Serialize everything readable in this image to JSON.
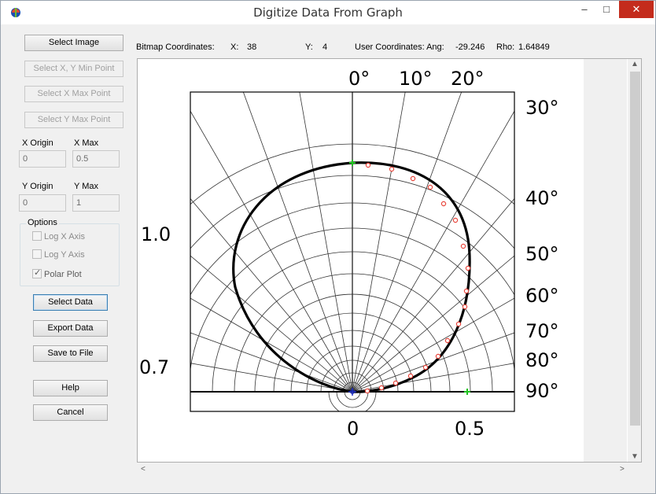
{
  "window": {
    "title": "Digitize Data From Graph",
    "minimize": "–",
    "maximize": "□",
    "close": "✕"
  },
  "buttons": {
    "select_image": "Select Image",
    "select_min": "Select X, Y Min Point",
    "select_xmax": "Select X Max Point",
    "select_ymax": "Select Y Max Point",
    "select_data": "Select Data",
    "export_data": "Export Data",
    "save_file": "Save to File",
    "help": "Help",
    "cancel": "Cancel"
  },
  "fields": {
    "x_origin_label": "X Origin",
    "x_origin_value": "0",
    "x_max_label": "X Max",
    "x_max_value": "0.5",
    "y_origin_label": "Y Origin",
    "y_origin_value": "0",
    "y_max_label": "Y Max",
    "y_max_value": "1"
  },
  "options": {
    "legend": "Options",
    "log_x": "Log X Axis",
    "log_y": "Log Y Axis",
    "polar": "Polar Plot",
    "log_x_checked": false,
    "log_y_checked": false,
    "polar_checked": true
  },
  "coords": {
    "bitmap_label": "Bitmap Coordinates:",
    "x_label": "X:",
    "x_value": "38",
    "y_label": "Y:",
    "y_value": "4",
    "user_label": "User Coordinates: Ang:",
    "ang_value": "-29.246",
    "rho_label": "Rho:",
    "rho_value": "1.64849"
  },
  "graph": {
    "top_labels": [
      "0°",
      "10°",
      "20°"
    ],
    "right_labels": [
      "30°",
      "40°",
      "50°",
      "60°",
      "70°",
      "80°",
      "90°"
    ],
    "left_labels": [
      "1.0",
      "0.7"
    ],
    "bottom_labels": [
      "0",
      "0.5"
    ]
  },
  "scroll": {
    "up": "▲",
    "down": "▼",
    "left": "<",
    "right": ">"
  },
  "colors": {
    "close_red": "#c42b1c",
    "marker_red": "#e8463c",
    "marker_green": "#22c222",
    "marker_blue": "#2030c8"
  }
}
